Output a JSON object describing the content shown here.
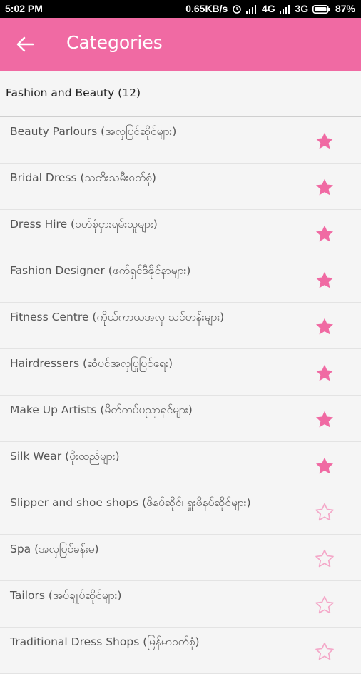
{
  "status_bar": {
    "time": "5:02 PM",
    "net_speed": "0.65KB/s",
    "network_1": "4G",
    "network_2": "3G",
    "battery": "87%"
  },
  "app_bar": {
    "title": "Categories",
    "back_icon": "arrow-left-icon",
    "color": "#f06aa3"
  },
  "section": {
    "header": "Fashion and Beauty (12)"
  },
  "colors": {
    "accent": "#f06aa3",
    "star_filled": "#f06aa3",
    "star_outline": "#f4a7c8"
  },
  "categories": [
    {
      "label": "Beauty Parlours (အလှပြင်ဆိုင်များ)",
      "favorite": true
    },
    {
      "label": "Bridal Dress (သတိုးသမီးဝတ်စုံ)",
      "favorite": true
    },
    {
      "label": "Dress Hire (ဝတ်စုံငှားရမ်းသူများ)",
      "favorite": true
    },
    {
      "label": "Fashion Designer (ဖက်ရှင်ဒီဇိုင်နာများ)",
      "favorite": true
    },
    {
      "label": "Fitness Centre (ကိုယ်ကာယအလှ သင်တန်းများ)",
      "favorite": true
    },
    {
      "label": "Hairdressers (ဆံပင်အလှပြုပြင်ရေး)",
      "favorite": true
    },
    {
      "label": "Make Up Artists (မိတ်ကပ်ပညာရှင်များ)",
      "favorite": true
    },
    {
      "label": "Silk Wear (ပိုးထည်များ)",
      "favorite": true
    },
    {
      "label": "Slipper and shoe shops (ဖိနပ်ဆိုင်၊ ရှူးဖိနပ်ဆိုင်များ)",
      "favorite": false
    },
    {
      "label": "Spa (အလှပြင်ခန်းမ)",
      "favorite": false
    },
    {
      "label": "Tailors (အပ်ချုပ်ဆိုင်များ)",
      "favorite": false
    },
    {
      "label": "Traditional Dress Shops (မြန်မာဝတ်စုံ)",
      "favorite": false
    }
  ]
}
